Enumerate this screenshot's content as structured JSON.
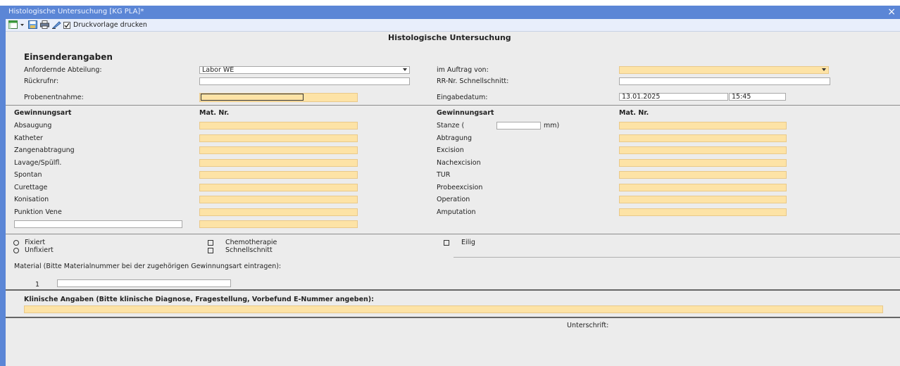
{
  "window": {
    "title": "Histologische Untersuchung [KG PLA]*",
    "close_glyph": "×"
  },
  "toolbar": {
    "print_template_label": "Druckvorlage drucken",
    "print_template_checked": true
  },
  "form": {
    "title": "Histologische Untersuchung",
    "section_sender": "Einsenderangaben",
    "labels": {
      "dept": "Anfordernde Abteilung:",
      "callback": "Rückrufnr:",
      "sampling": "Probenentnahme:",
      "on_behalf": "im Auftrag von:",
      "rr_quick": "RR-Nr. Schnellschnitt:",
      "entry_date": "Eingabedatum:"
    },
    "values": {
      "dept": "Labor WE",
      "entry_date": "13.01.2025",
      "entry_time": "15:45"
    },
    "table_headers": {
      "method": "Gewinnungsart",
      "mat_nr": "Mat. Nr."
    },
    "left_methods": [
      "Absaugung",
      "Katheter",
      "Zangenabtragung",
      "Lavage/Spülfl.",
      "Spontan",
      "Curettage",
      "Konisation",
      "Punktion Vene"
    ],
    "right_methods": [
      "Stanze (",
      "Abtragung",
      "Excision",
      "Nachexcision",
      "TUR",
      "Probeexcision",
      "Operation",
      "Amputation"
    ],
    "stanze_unit": "mm)",
    "options": {
      "fixiert": "Fixiert",
      "unfixiert": "Unfixiert",
      "chemotherapie": "Chemotherapie",
      "schnellschnitt": "Schnellschnitt",
      "eilig": "Eilig"
    },
    "material_note": "Material (Bitte Materialnummer bei der zugehörigen Gewinnungsart eintragen):",
    "material_row_no": "1",
    "clinical_header": "Klinische Angaben (Bitte klinische Diagnose, Fragestellung, Vorbefund E-Nummer angeben):",
    "signature_label": "Unterschrift:"
  },
  "colors": {
    "titlebar": "#5b86d6",
    "required_field": "#fde3a6",
    "form_background": "#ececec"
  }
}
